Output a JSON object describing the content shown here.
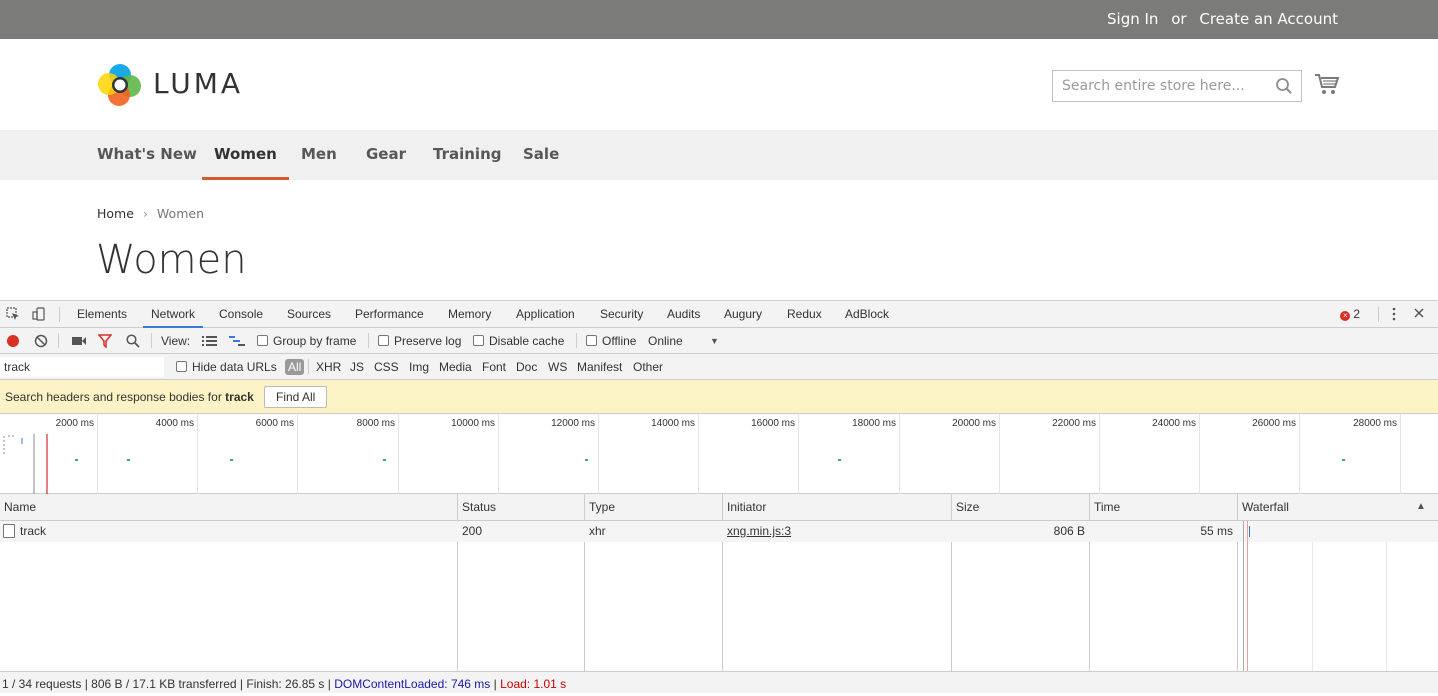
{
  "topbar": {
    "sign_in": "Sign In",
    "or": "or",
    "create_account": "Create an Account"
  },
  "brand": {
    "name": "LUMA",
    "colors": [
      "#f26322",
      "#00a0e3",
      "#5fb748",
      "#ffd400"
    ]
  },
  "search": {
    "placeholder": "Search entire store here..."
  },
  "nav": {
    "items": [
      {
        "label": "What's New"
      },
      {
        "label": "Women",
        "active": true
      },
      {
        "label": "Men"
      },
      {
        "label": "Gear"
      },
      {
        "label": "Training"
      },
      {
        "label": "Sale"
      }
    ]
  },
  "breadcrumb": {
    "home": "Home",
    "separator": "›",
    "current": "Women"
  },
  "page": {
    "title": "Women"
  },
  "devtools": {
    "tabs": [
      "Elements",
      "Network",
      "Console",
      "Sources",
      "Performance",
      "Memory",
      "Application",
      "Security",
      "Audits",
      "Augury",
      "Redux",
      "AdBlock"
    ],
    "active_tab": "Network",
    "error_count": "2",
    "error_glyph": "×",
    "toolbar": {
      "view_label": "View:",
      "group_by_frame": "Group by frame",
      "preserve_log": "Preserve log",
      "disable_cache": "Disable cache",
      "offline": "Offline",
      "throttle": "Online",
      "dropdown_glyph": "▼"
    },
    "filter": {
      "value": "track",
      "hide_data_urls": "Hide data URLs",
      "types": [
        "All",
        "XHR",
        "JS",
        "CSS",
        "Img",
        "Media",
        "Font",
        "Doc",
        "WS",
        "Manifest",
        "Other"
      ]
    },
    "search_bar": {
      "message_prefix": "Search headers and response bodies for ",
      "term": "track",
      "button": "Find All"
    },
    "timeline_labels": [
      "2000 ms",
      "4000 ms",
      "6000 ms",
      "8000 ms",
      "10000 ms",
      "12000 ms",
      "14000 ms",
      "16000 ms",
      "18000 ms",
      "20000 ms",
      "22000 ms",
      "24000 ms",
      "26000 ms",
      "28000 ms"
    ],
    "columns": {
      "name": "Name",
      "status": "Status",
      "type": "Type",
      "initiator": "Initiator",
      "size": "Size",
      "time": "Time",
      "waterfall": "Waterfall",
      "sort_glyph": "▲"
    },
    "rows": [
      {
        "name": "track",
        "status": "200",
        "type": "xhr",
        "initiator": "xng.min.js:3",
        "size": "806 B",
        "time": "55 ms"
      }
    ],
    "status_bar": {
      "summary": "1 / 34 requests | 806 B / 17.1 KB transferred | Finish: 26.85 s | ",
      "dom_content_loaded": "DOMContentLoaded: 746 ms",
      "divider": " | ",
      "load": "Load: 1.01 s"
    }
  }
}
